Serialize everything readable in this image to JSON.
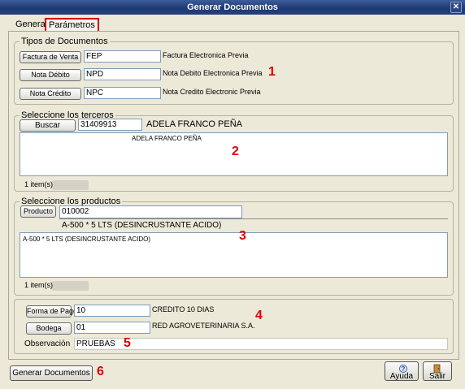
{
  "window": {
    "title": "Generar Documentos",
    "close_glyph": "✕"
  },
  "tabs": [
    {
      "label": "Generar"
    },
    {
      "label": "Parámetros"
    }
  ],
  "tipos_documentos": {
    "legend": "Tipos de Documentos",
    "rows": [
      {
        "button": "Factura de Venta",
        "code": "FEP",
        "description": "Factura Electronica Previa"
      },
      {
        "button": "Nota Débito",
        "code": "NPD",
        "description": "Nota Debito Electronica Previa"
      },
      {
        "button": "Nota Crédito",
        "code": "NPC",
        "description": "Nota Credito Electronic Previa"
      }
    ],
    "marker": "1"
  },
  "terceros": {
    "legend": "Seleccione los terceros",
    "search_button": "Buscar",
    "id_value": "31409913",
    "name": "ADELA FRANCO PEÑA",
    "list_items": [
      "ADELA FRANCO PEÑA"
    ],
    "count": "1 item(s)",
    "marker": "2"
  },
  "productos": {
    "legend": "Seleccione los productos",
    "button": "Producto",
    "code_value": "010002",
    "name": "A-500 * 5 LTS (DESINCRUSTANTE ACIDO)",
    "list_items": [
      "A-500 * 5 LTS (DESINCRUSTANTE ACIDO)"
    ],
    "count": "1 item(s)",
    "marker": "3"
  },
  "pago": {
    "forma_button": "Forma de Pago",
    "forma_value": "10",
    "forma_desc": "CREDITO 10 DIAS",
    "bodega_button": "Bodega",
    "bodega_value": "01",
    "bodega_desc": "RED AGROVETERINARIA S.A.",
    "observacion_label": "Observación",
    "observacion_value": "PRUEBAS",
    "marker_4": "4",
    "marker_5": "5"
  },
  "footer": {
    "generate_button": "Generar Documentos",
    "marker": "6",
    "help_button": "Ayuda",
    "exit_button": "Salir"
  },
  "icons": {
    "help": "help-icon",
    "exit": "exit-door-icon",
    "close": "close-icon"
  }
}
